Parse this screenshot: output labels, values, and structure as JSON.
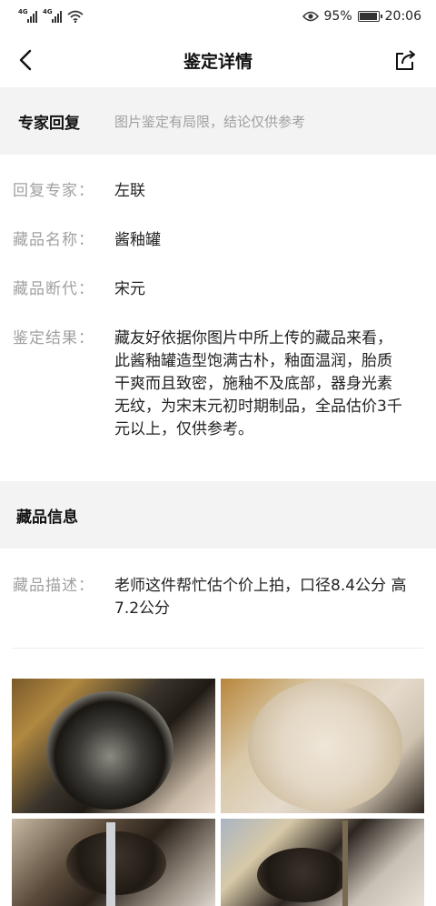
{
  "status_bar": {
    "signal1_label": "4G",
    "signal2_label": "4G",
    "battery_percent": "95%",
    "battery_level": 0.95,
    "time": "20:06"
  },
  "nav": {
    "title": "鉴定详情",
    "back_icon": "chevron-left-icon",
    "share_icon": "share-icon"
  },
  "expert_reply": {
    "header": "专家回复",
    "note": "图片鉴定有局限，结论仅供参考",
    "rows": [
      {
        "key": "回复专家：",
        "value": "左联"
      },
      {
        "key": "藏品名称：",
        "value": "酱釉罐"
      },
      {
        "key": "藏品断代：",
        "value": "宋元"
      },
      {
        "key": "鉴定结果：",
        "value": "藏友好依据你图片中所上传的藏品来看，此酱釉罐造型饱满古朴，釉面温润，胎质干爽而且致密，施釉不及底部，器身光素无纹，为宋末元初时期制品，全品估价3千元以上，仅供参考。"
      }
    ]
  },
  "collection_info": {
    "header": "藏品信息",
    "description_key": "藏品描述：",
    "description_value": "老师这件帮忙估个价上拍，口径8.4公分 高7.2公分"
  },
  "photos": [
    "jar-mouth-photo",
    "jar-base-photo",
    "jar-measure-photo",
    "jar-side-photo"
  ]
}
